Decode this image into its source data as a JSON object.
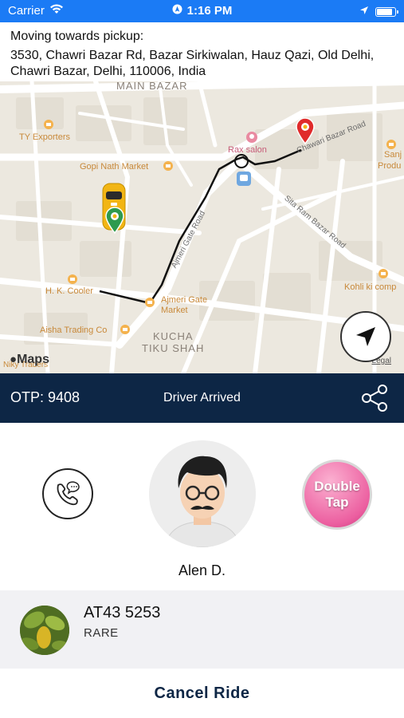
{
  "status_bar": {
    "carrier": "Carrier",
    "time": "1:16 PM",
    "icons": [
      "wifi-icon",
      "location-services-icon",
      "location-arrow-icon",
      "battery-icon"
    ],
    "color": "#1b7bf5"
  },
  "pickup": {
    "label": "Moving towards pickup:",
    "address": "3530, Chawri Bazar Rd, Bazar Sirkiwalan, Hauz Qazi, Old Delhi, Chawri Bazar, Delhi, 110006, India"
  },
  "map": {
    "places": {
      "main_bazar": "MAIN BAZAR",
      "ty_exporters": "TY Exporters",
      "gopi_nath": "Gopi Nath Market",
      "rax_salon": "Rax salon",
      "sanj": "Sanj",
      "produ": "Produ",
      "hk_cooler": "H. K. Cooler",
      "ajmeri_gate_market_1": "Ajmeri Gate",
      "ajmeri_gate_market_2": "Market",
      "aisha_trading": "Aisha Trading Co",
      "kohli": "Kohli ki comp",
      "kucha_1": "KUCHA",
      "kucha_2": "TIKU SHAH",
      "niky": "Niky Traders"
    },
    "streets": {
      "chawri_bazar_road": "Chawari Bazar Road",
      "ajmeri_gate_road": "Ajmeri Gate Road",
      "sita_ram_bazar_road": "Sita Ram Bazar Road"
    },
    "attribution": "Maps",
    "legal": "Legal",
    "icons": [
      "taxi-icon",
      "destination-pin-icon",
      "poi-icon",
      "metro-icon",
      "navigation-arrow-icon"
    ]
  },
  "otp_bar": {
    "otp": "OTP: 9408",
    "status": "Driver Arrived",
    "color": "#0d2645"
  },
  "driver": {
    "name": "Alen D.",
    "double_tap_line1": "Double",
    "double_tap_line2": "Tap"
  },
  "vehicle": {
    "plate": "AT43 5253",
    "model": "RARE"
  },
  "actions": {
    "cancel": "Cancel Ride"
  }
}
